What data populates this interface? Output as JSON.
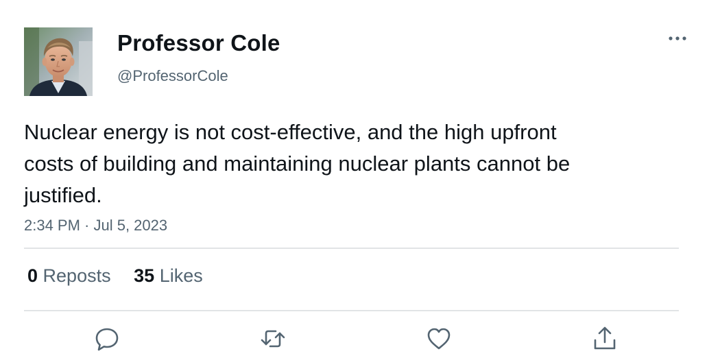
{
  "author": {
    "display_name": "Professor Cole",
    "handle": "@ProfessorCole",
    "avatar_icon": "profile-photo"
  },
  "tweet": {
    "text": "Nuclear energy is not cost-effective, and the high upfront costs of building and maintaining nuclear plants cannot be justified.",
    "timestamp": "2:34 PM · Jul 5, 2023"
  },
  "stats": {
    "reposts_count": "0",
    "reposts_label": "Reposts",
    "likes_count": "35",
    "likes_label": "Likes"
  },
  "actions": {
    "reply_icon": "reply-icon",
    "repost_icon": "repost-icon",
    "like_icon": "heart-icon",
    "share_icon": "share-icon",
    "more_icon": "more-icon"
  },
  "colors": {
    "text_primary": "#0f1419",
    "text_secondary": "#536471",
    "divider": "#e1e4e6",
    "icon": "#536471"
  }
}
